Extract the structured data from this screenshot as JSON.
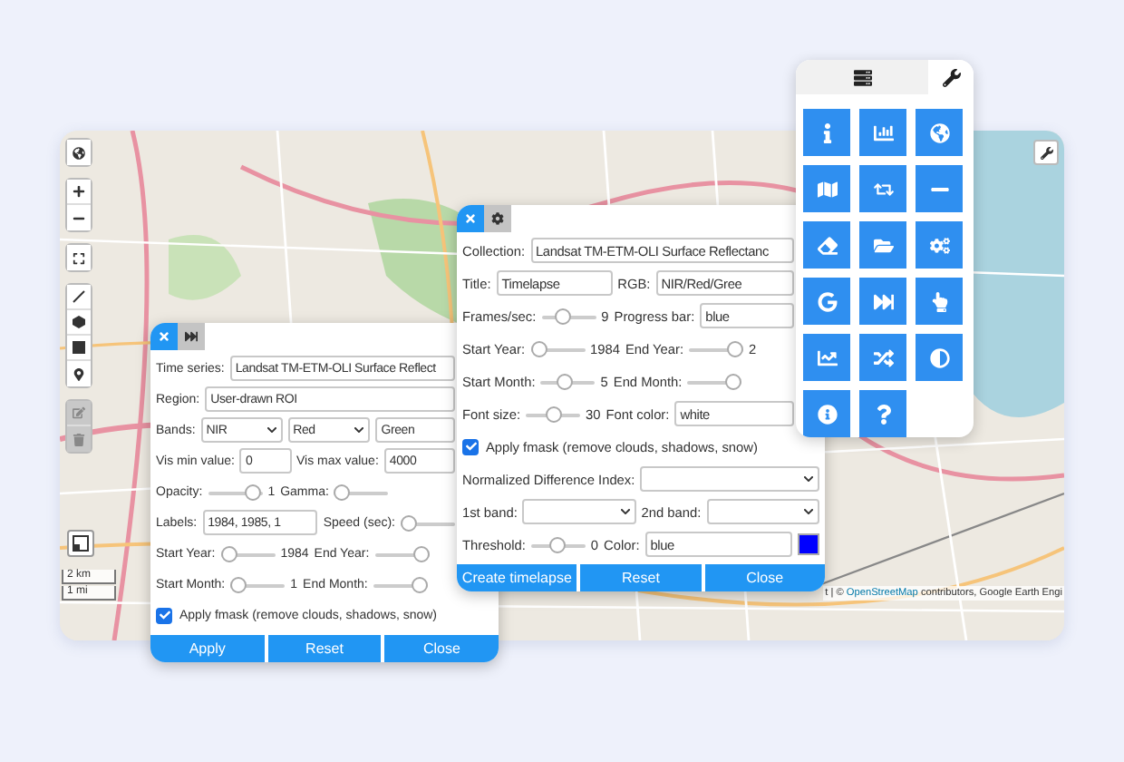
{
  "map": {
    "draw_tools": [
      {
        "disabled": false
      },
      {
        "disabled": false
      },
      {
        "disabled": false
      },
      {
        "disabled": false
      },
      {
        "disabled": true
      },
      {
        "disabled": true
      }
    ],
    "scale": [
      "2 km",
      "1 mi"
    ],
    "attribution": {
      "prefix": "t | © ",
      "link": "OpenStreetMap",
      "suffix": " contributors, Google Earth Engi"
    }
  },
  "panels": [
    {
      "tabs": [
        {
          "selected": true
        },
        {
          "selected": false
        }
      ],
      "rows": [
        [
          {
            "kind": "label",
            "text": "Time series:"
          },
          {
            "kind": "input",
            "value": "Landsat TM-ETM-OLI Surface Reflect"
          }
        ],
        [
          {
            "kind": "label",
            "text": "Region:"
          },
          {
            "kind": "input",
            "value": "User-drawn ROI"
          }
        ],
        [
          {
            "kind": "label",
            "text": "Bands:"
          },
          {
            "kind": "select",
            "value": "NIR"
          },
          {
            "kind": "select",
            "value": "Red"
          },
          {
            "kind": "input",
            "value": "Green"
          }
        ],
        [
          {
            "kind": "label",
            "text": "Vis min value:"
          },
          {
            "kind": "input",
            "value": "0"
          },
          {
            "kind": "label",
            "text": "Vis max value:"
          },
          {
            "kind": "input",
            "value": "4000"
          }
        ],
        [
          {
            "kind": "label",
            "text": "Opacity:"
          },
          {
            "kind": "slider",
            "level": 0.95,
            "reading": "1"
          },
          {
            "kind": "label",
            "text": "Gamma:"
          },
          {
            "kind": "slider",
            "level": 0
          }
        ],
        [
          {
            "kind": "label",
            "text": "Labels:"
          },
          {
            "kind": "input",
            "value": "1984, 1985, 1"
          },
          {
            "kind": "label",
            "text": "Speed (sec):"
          },
          {
            "kind": "slider",
            "level": 0
          }
        ],
        [
          {
            "kind": "label",
            "text": "Start Year:"
          },
          {
            "kind": "slider",
            "level": 0,
            "reading": "1984"
          },
          {
            "kind": "label",
            "text": "End Year:"
          },
          {
            "kind": "slider",
            "level": 1
          }
        ],
        [
          {
            "kind": "label",
            "text": "Start Month:"
          },
          {
            "kind": "slider",
            "level": 0,
            "reading": "1"
          },
          {
            "kind": "label",
            "text": "End Month:"
          },
          {
            "kind": "slider",
            "level": 1
          }
        ],
        [
          {
            "kind": "check",
            "checked": true,
            "text": "Apply fmask (remove clouds, shadows, snow)"
          }
        ]
      ],
      "buttons": [
        "Apply",
        "Reset",
        "Close"
      ]
    },
    {
      "tabs": [
        {
          "selected": true
        },
        {
          "selected": false
        }
      ],
      "rows": [
        [
          {
            "kind": "label",
            "text": "Collection:"
          },
          {
            "kind": "input",
            "value": "Landsat TM-ETM-OLI Surface Reflectanc"
          }
        ],
        [
          {
            "kind": "label",
            "text": "Title:"
          },
          {
            "kind": "input",
            "value": "Timelapse"
          },
          {
            "kind": "label",
            "text": "RGB:"
          },
          {
            "kind": "input",
            "value": "NIR/Red/Gree"
          }
        ],
        [
          {
            "kind": "label",
            "text": "Frames/sec:"
          },
          {
            "kind": "slider",
            "level": 0.35,
            "reading": "9"
          },
          {
            "kind": "label",
            "text": "Progress bar:"
          },
          {
            "kind": "input",
            "value": "blue"
          }
        ],
        [
          {
            "kind": "label",
            "text": "Start Year:"
          },
          {
            "kind": "slider",
            "level": 0,
            "reading": "1984"
          },
          {
            "kind": "label",
            "text": "End Year:"
          },
          {
            "kind": "slider",
            "level": 1,
            "reading": "2"
          }
        ],
        [
          {
            "kind": "label",
            "text": "Start Month:"
          },
          {
            "kind": "slider",
            "level": 0.4,
            "reading": "5"
          },
          {
            "kind": "label",
            "text": "End Month:"
          },
          {
            "kind": "slider",
            "level": 1
          }
        ],
        [
          {
            "kind": "label",
            "text": "Font size:"
          },
          {
            "kind": "slider",
            "level": 0.5,
            "reading": "30"
          },
          {
            "kind": "label",
            "text": "Font color:"
          },
          {
            "kind": "input",
            "value": "white"
          }
        ],
        [
          {
            "kind": "check",
            "checked": true,
            "text": "Apply fmask (remove clouds, shadows, snow)"
          }
        ],
        [
          {
            "kind": "label",
            "text": "Normalized Difference Index:"
          },
          {
            "kind": "select"
          }
        ],
        [
          {
            "kind": "label",
            "text": "1st band:"
          },
          {
            "kind": "select"
          },
          {
            "kind": "label",
            "text": "2nd band:"
          },
          {
            "kind": "select"
          }
        ],
        [
          {
            "kind": "label",
            "text": "Threshold:"
          },
          {
            "kind": "slider",
            "level": 0.5,
            "reading": "0"
          },
          {
            "kind": "label",
            "text": "Color:"
          },
          {
            "kind": "input",
            "value": "blue"
          },
          {
            "kind": "color",
            "color": "#0000ff"
          }
        ]
      ],
      "buttons": [
        "Create timelapse",
        "Reset",
        "Close"
      ]
    }
  ],
  "tool_panel": {
    "tabs": [
      {
        "selected": false
      },
      {
        "selected": true
      }
    ]
  }
}
